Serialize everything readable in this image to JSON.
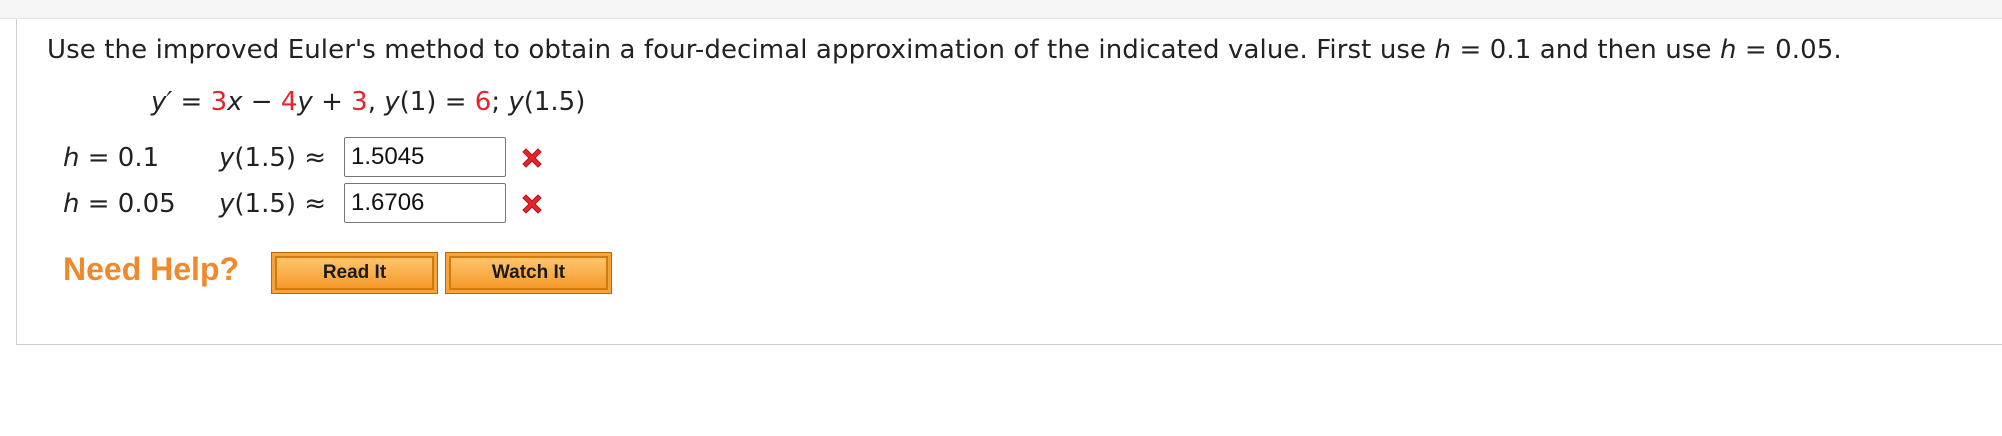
{
  "question": {
    "text_before_h1": "Use the improved Euler's method to obtain a four-decimal approximation of the indicated value. First use ",
    "h_symbol": "h",
    "h1_value": " = 0.1",
    "text_middle": " and then use ",
    "h2_value": " = 0.05."
  },
  "equation": {
    "lhs": "y′ = ",
    "coef_x": "3",
    "x_var": "x",
    "minus": " − ",
    "coef_y": "4",
    "y_var": "y",
    "plus": " + ",
    "const": "3",
    "comma": ", ",
    "init_fn": "y",
    "init_arg": "(1) = ",
    "init_val": "6",
    "semicolon": ";  ",
    "target_fn": "y",
    "target_arg": "(1.5)"
  },
  "rows": [
    {
      "h_label_var": "h",
      "h_label_val": " = 0.1",
      "y_label_var": "y",
      "y_label_rest": "(1.5) ≈",
      "answer": "1.5045",
      "status_icon": "incorrect-x-icon"
    },
    {
      "h_label_var": "h",
      "h_label_val": " = 0.05",
      "y_label_var": "y",
      "y_label_rest": "(1.5) ≈",
      "answer": "1.6706",
      "status_icon": "incorrect-x-icon"
    }
  ],
  "help": {
    "label": "Need Help?",
    "read_it": "Read It",
    "watch_it": "Watch It"
  },
  "colors": {
    "highlight": "#e8232a",
    "help_label": "#f0892a",
    "button_fill": "#f7a33c",
    "incorrect": "#e8232a"
  }
}
